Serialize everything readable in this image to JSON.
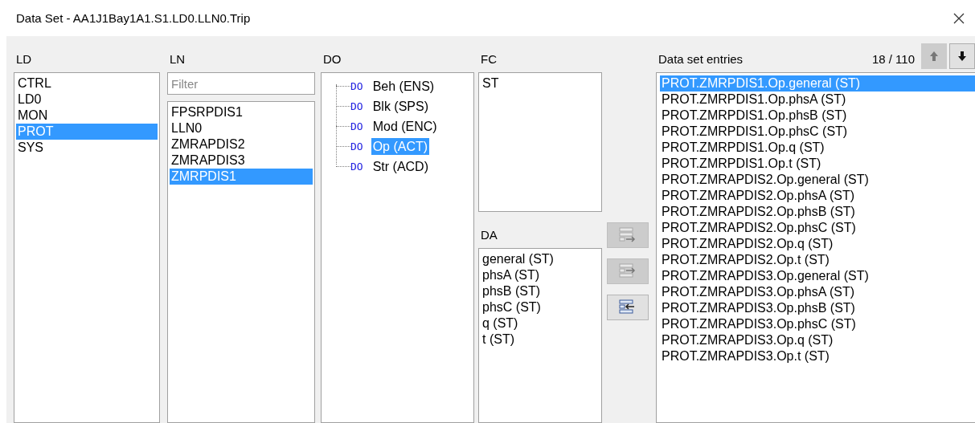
{
  "window": {
    "title": "Data Set - AA1J1Bay1A1.S1.LD0.LLN0.Trip"
  },
  "ld": {
    "label": "LD",
    "items": [
      {
        "text": "CTRL",
        "selected": false
      },
      {
        "text": "LD0",
        "selected": false
      },
      {
        "text": "MON",
        "selected": false
      },
      {
        "text": "PROT",
        "selected": true
      },
      {
        "text": "SYS",
        "selected": false
      }
    ]
  },
  "ln": {
    "label": "LN",
    "filter": {
      "placeholder": "Filter"
    },
    "items": [
      {
        "text": "FPSRPDIS1",
        "selected": false
      },
      {
        "text": "LLN0",
        "selected": false
      },
      {
        "text": "ZMRAPDIS2",
        "selected": false
      },
      {
        "text": "ZMRAPDIS3",
        "selected": false
      },
      {
        "text": "ZMRPDIS1",
        "selected": true
      }
    ]
  },
  "do": {
    "label": "DO",
    "items": [
      {
        "tag": "DO",
        "text": "Beh (ENS)",
        "selected": false
      },
      {
        "tag": "DO",
        "text": "Blk (SPS)",
        "selected": false
      },
      {
        "tag": "DO",
        "text": "Mod (ENC)",
        "selected": false
      },
      {
        "tag": "DO",
        "text": "Op (ACT)",
        "selected": true
      },
      {
        "tag": "DO",
        "text": "Str (ACD)",
        "selected": false
      }
    ]
  },
  "fc": {
    "label": "FC",
    "items": [
      {
        "text": "ST",
        "selected": false
      }
    ]
  },
  "da": {
    "label": "DA",
    "items": [
      {
        "text": "general (ST)",
        "selected": false
      },
      {
        "text": "phsA (ST)",
        "selected": false
      },
      {
        "text": "phsB (ST)",
        "selected": false
      },
      {
        "text": "phsC (ST)",
        "selected": false
      },
      {
        "text": "q (ST)",
        "selected": false
      },
      {
        "text": "t (ST)",
        "selected": false
      }
    ]
  },
  "transfer_buttons": [
    {
      "kind": "add-all",
      "disabled": true
    },
    {
      "kind": "add",
      "disabled": true
    },
    {
      "kind": "remove",
      "disabled": false
    }
  ],
  "entries": {
    "label": "Data set entries",
    "count": "18 / 110",
    "move_up": {
      "disabled": true
    },
    "move_down": {
      "disabled": false
    },
    "items": [
      {
        "text": "PROT.ZMRPDIS1.Op.general (ST)",
        "selected": true
      },
      {
        "text": "PROT.ZMRPDIS1.Op.phsA (ST)",
        "selected": false
      },
      {
        "text": "PROT.ZMRPDIS1.Op.phsB (ST)",
        "selected": false
      },
      {
        "text": "PROT.ZMRPDIS1.Op.phsC (ST)",
        "selected": false
      },
      {
        "text": "PROT.ZMRPDIS1.Op.q (ST)",
        "selected": false
      },
      {
        "text": "PROT.ZMRPDIS1.Op.t (ST)",
        "selected": false
      },
      {
        "text": "PROT.ZMRAPDIS2.Op.general (ST)",
        "selected": false
      },
      {
        "text": "PROT.ZMRAPDIS2.Op.phsA (ST)",
        "selected": false
      },
      {
        "text": "PROT.ZMRAPDIS2.Op.phsB (ST)",
        "selected": false
      },
      {
        "text": "PROT.ZMRAPDIS2.Op.phsC (ST)",
        "selected": false
      },
      {
        "text": "PROT.ZMRAPDIS2.Op.q (ST)",
        "selected": false
      },
      {
        "text": "PROT.ZMRAPDIS2.Op.t (ST)",
        "selected": false
      },
      {
        "text": "PROT.ZMRAPDIS3.Op.general (ST)",
        "selected": false
      },
      {
        "text": "PROT.ZMRAPDIS3.Op.phsA (ST)",
        "selected": false
      },
      {
        "text": "PROT.ZMRAPDIS3.Op.phsB (ST)",
        "selected": false
      },
      {
        "text": "PROT.ZMRAPDIS3.Op.phsC (ST)",
        "selected": false
      },
      {
        "text": "PROT.ZMRAPDIS3.Op.q (ST)",
        "selected": false
      },
      {
        "text": "PROT.ZMRAPDIS3.Op.t (ST)",
        "selected": false
      }
    ]
  }
}
